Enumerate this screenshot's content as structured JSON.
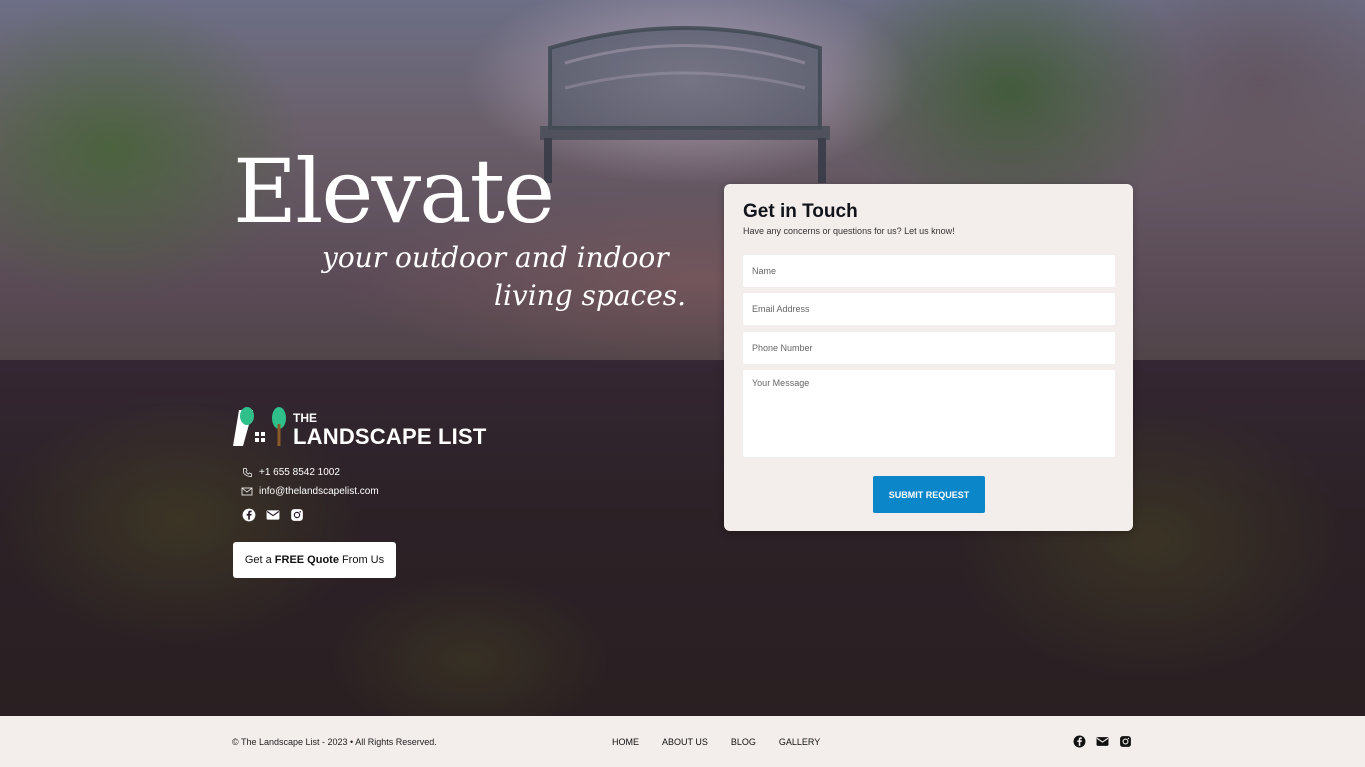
{
  "hero": {
    "headline": "Elevate",
    "subline_1": "your outdoor and indoor",
    "subline_2": "living spaces."
  },
  "brand": {
    "logo_small": "THE",
    "logo_name": "LANDSCAPE LIST",
    "logo_colors": {
      "leaf": "#2fbf8a",
      "trunk": "#8a5a2a"
    },
    "phone": "+1 655 8542 1002",
    "email": "info@thelandscapelist.com",
    "social_icons": [
      "facebook-icon",
      "mail-icon",
      "instagram-icon"
    ]
  },
  "quote_button": {
    "prefix": "Get a",
    "bold": "FREE Quote",
    "suffix": "From Us"
  },
  "form": {
    "title": "Get in Touch",
    "subtitle": "Have any concerns or questions for us? Let us know!",
    "name_placeholder": "Name",
    "email_placeholder": "Email Address",
    "phone_placeholder": "Phone Number",
    "message_placeholder": "Your Message",
    "submit_label": "SUBMIT REQUEST",
    "accent_color": "#0b86c9"
  },
  "footer": {
    "copyright": "© The Landscape List - 2023 • All Rights Reserved.",
    "nav": [
      "HOME",
      "ABOUT US",
      "BLOG",
      "GALLERY"
    ],
    "social_icons": [
      "facebook-icon",
      "mail-icon",
      "instagram-icon"
    ]
  }
}
